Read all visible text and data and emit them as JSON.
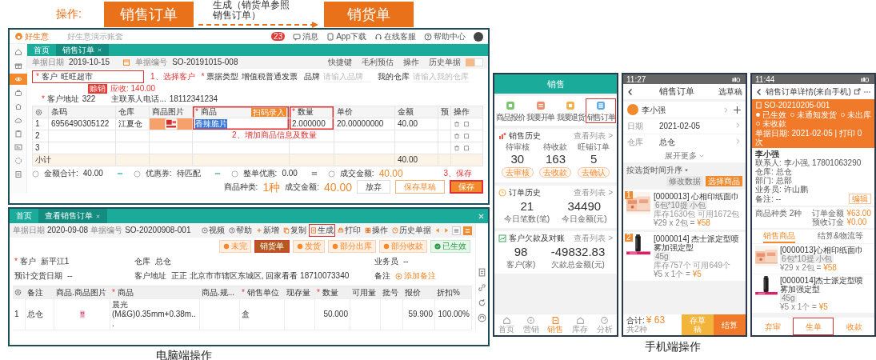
{
  "flow": {
    "label": "操作:",
    "from": "销售订单",
    "via": "生成（销货单参照销售订单）",
    "to": "销货单"
  },
  "pc_edit": {
    "logo": "好生意",
    "account": "好生意演示账套",
    "top_actions": [
      {
        "kind": "message",
        "label": "消息",
        "badge": "23"
      },
      {
        "kind": "app",
        "label": "App下载"
      },
      {
        "kind": "service",
        "label": "在线客服"
      },
      {
        "kind": "help",
        "label": "帮助中心"
      }
    ],
    "sidebar": [
      {
        "kind": "home",
        "selected": false
      },
      {
        "kind": "gift",
        "selected": false
      },
      {
        "kind": "eye",
        "selected": true
      },
      {
        "kind": "bag",
        "selected": false
      },
      {
        "kind": "house",
        "selected": false
      },
      {
        "kind": "cloud",
        "selected": false
      },
      {
        "kind": "clipboard",
        "selected": false
      },
      {
        "kind": "card",
        "selected": false
      },
      {
        "kind": "ring",
        "selected": false
      },
      {
        "kind": "doc",
        "selected": false
      }
    ],
    "tabs": [
      {
        "label": "首页",
        "selected": false,
        "closable": false
      },
      {
        "label": "销售订单",
        "selected": true,
        "closable": true
      }
    ],
    "date_label": "单据日期",
    "date": "2019-10-15",
    "number_label": "单据编号",
    "number": "SO-20191015-008",
    "header_actions": [
      "快捷键",
      "毛利预估",
      "操作",
      "历史单据"
    ],
    "view_toggle": [
      {
        "selected": true
      },
      {
        "selected": false
      }
    ],
    "customer": {
      "mark": "*",
      "label": "客户",
      "value": "旺旺超市",
      "highlighted": true,
      "badge": "赊销",
      "receivable": "应收: 140.00"
    },
    "step1": "1、选择客户",
    "invoice": {
      "mark": "*",
      "label": "票据类型",
      "value": "增值税普通发票"
    },
    "brand": {
      "label": "品牌",
      "placeholder": "请输入品牌"
    },
    "warehouse": {
      "label": "我的仓库",
      "placeholder": "请输入我的仓库"
    },
    "address": {
      "mark": "*",
      "label": "客户地址",
      "value": "322"
    },
    "contact": {
      "label": "主联系人电话...",
      "value": "18112341234"
    },
    "columns": [
      {
        "label": "条码",
        "highlighted": false
      },
      {
        "label": "仓库",
        "highlighted": false
      },
      {
        "label": "商品图片",
        "highlighted": false
      },
      {
        "mark": "*",
        "label": "商品",
        "highlighted": true,
        "badge": "扫码录入"
      },
      {
        "mark": "*",
        "label": "数量",
        "highlighted": true
      },
      {
        "label": "单价",
        "highlighted": false
      },
      {
        "label": "金额",
        "highlighted": false
      },
      {
        "label": "预",
        "highlighted": false
      },
      {
        "label": "操作",
        "highlighted": false
      }
    ],
    "rows": [
      {
        "index": "1",
        "barcode": "6956490305122",
        "warehouse": "江夏仓",
        "has_picture": true,
        "product": "香辣脆片",
        "quantity": "2.000000",
        "price": "20.00000000",
        "amount": "40.00"
      },
      {
        "index": "2",
        "has_picture": false
      },
      {
        "index": "3",
        "has_picture": false
      }
    ],
    "subtotal": {
      "label": "小计",
      "amount": "40.00"
    },
    "step2": "2、增加商品信息及数量",
    "totals": [
      {
        "label": "金额合计:",
        "value": "40.00",
        "kind": "minus"
      },
      {
        "label": "优惠券:",
        "value": "待匹配",
        "kind": "minus"
      },
      {
        "label": "整单优惠:",
        "value": "0.00",
        "kind": "equals"
      },
      {
        "label": "成交金额:",
        "value": "40.00",
        "kind": "result"
      }
    ],
    "step3": "3、保存",
    "footer": {
      "kinds_label": "商品种类:",
      "kinds": "1种",
      "amount_label": "成交金额:",
      "amount": "40.00",
      "buttons": [
        {
          "label": "放弃",
          "kind": "plain",
          "highlighted": false
        },
        {
          "label": "保存草稿",
          "kind": "outline",
          "highlighted": false
        },
        {
          "label": "保存",
          "kind": "primary",
          "highlighted": true
        }
      ]
    }
  },
  "pc_view": {
    "tabs": [
      {
        "label": "首页",
        "selected": false,
        "closable": false
      },
      {
        "label": "查看销售订单",
        "selected": true,
        "closable": true
      }
    ],
    "date_label": "单据日期",
    "date": "2020-09-08",
    "number_label": "单据编号",
    "number": "SO-20200908-001",
    "toolbar": [
      {
        "kind": "video",
        "label": "视频",
        "highlighted": false
      },
      {
        "kind": "help",
        "label": "帮助",
        "highlighted": false
      },
      {
        "kind": "add",
        "label": "新增",
        "highlighted": false
      },
      {
        "kind": "copy",
        "label": "复制",
        "highlighted": false
      },
      {
        "kind": "generate",
        "label": "生成",
        "highlighted": true
      },
      {
        "kind": "print",
        "label": "打印",
        "highlighted": false
      },
      {
        "kind": "ops",
        "label": "操作",
        "highlighted": false
      },
      {
        "kind": "history",
        "label": "历史单据",
        "highlighted": false
      }
    ],
    "menu_item": "销货单",
    "chips": [
      {
        "label": "未完",
        "done": false
      },
      {
        "label": "发货",
        "done": false
      },
      {
        "label": "部分出库",
        "done": false
      },
      {
        "label": "部分收款",
        "done": false
      },
      {
        "label": "已生效",
        "done": true
      }
    ],
    "fields": [
      {
        "mark": "*",
        "label": "客户",
        "value": "新平江1",
        "kind": "text"
      },
      {
        "label": "仓库",
        "value": "总仓",
        "kind": "text"
      },
      {
        "label": "业务员",
        "value": "--",
        "kind": "text"
      },
      {
        "label": "预计交货日期",
        "value": "--",
        "kind": "text"
      },
      {
        "label": "客户地址",
        "value": "正正 北京市市辖区东城区, 回家看看 18710073340",
        "kind": "text"
      },
      {
        "label": "备注",
        "value": "添加备注",
        "kind": "link"
      }
    ],
    "columns": [
      {
        "label": "备注"
      },
      {
        "label": "商品.商品图片"
      },
      {
        "mark": "*",
        "label": "商品"
      },
      {
        "label": "商品.规..."
      },
      {
        "mark": "*",
        "label": "销售单位"
      },
      {
        "label": "现存量"
      },
      {
        "mark": "*",
        "label": "数量"
      },
      {
        "label": "可用量"
      },
      {
        "label": "批号"
      },
      {
        "label": "报价"
      },
      {
        "label": "折扣%"
      }
    ],
    "rows": [
      {
        "index": "1",
        "cells": [
          {
            "kind": "text",
            "text": "总仓"
          },
          {
            "kind": "picture"
          },
          {
            "kind": "text",
            "text": "晨光 (M&G)0.35mm+0.38m..."
          },
          {
            "kind": "empty"
          },
          {
            "kind": "text",
            "text": "盒"
          },
          {
            "kind": "empty"
          },
          {
            "kind": "number",
            "text": "50.000"
          },
          {
            "kind": "empty"
          },
          {
            "kind": "empty"
          },
          {
            "kind": "number",
            "text": "59.900"
          },
          {
            "kind": "number",
            "text": "100.00%"
          }
        ]
      }
    ]
  },
  "pc_caption": "电脑端操作",
  "phone_home": {
    "title": "销售",
    "tiles": [
      {
        "kind": "quote",
        "label": "商品报价",
        "highlighted": false
      },
      {
        "kind": "order",
        "label": "我要开单",
        "highlighted": false
      },
      {
        "kind": "return",
        "label": "我要退货",
        "highlighted": false
      },
      {
        "kind": "list",
        "label": "销售订单",
        "highlighted": true
      }
    ],
    "sections": [
      {
        "kind": "history",
        "title": "销售历史",
        "link": "查看列表 >",
        "stats": [
          {
            "label": "待审核",
            "value": "30",
            "action": "去审核"
          },
          {
            "label": "待收款",
            "value": "163",
            "action": "去收款"
          },
          {
            "label": "旺铺订单",
            "value": "5",
            "action": "去确认"
          }
        ]
      },
      {
        "kind": "orders",
        "title": "订单历史",
        "link": "查看列表 >",
        "stats": [
          {
            "value": "21",
            "label": "今日笔数(笔)"
          },
          {
            "value": "34490",
            "label": "今日金额(元)"
          }
        ]
      },
      {
        "kind": "debt",
        "title": "客户欠款及对账",
        "link": "查看列表 >",
        "stats": [
          {
            "value": "98",
            "label": "客户(家)"
          },
          {
            "value": "-49832.83",
            "label": "欠款总金额(元)"
          }
        ]
      }
    ],
    "nav": [
      {
        "kind": "home",
        "label": "首页",
        "selected": false
      },
      {
        "kind": "market",
        "label": "营销",
        "selected": false
      },
      {
        "kind": "sales",
        "label": "销售",
        "selected": true
      },
      {
        "kind": "stock",
        "label": "库存",
        "selected": false
      },
      {
        "kind": "analysis",
        "label": "分析",
        "selected": false
      }
    ]
  },
  "phone_order": {
    "time": "11:27",
    "title": "销售订单",
    "action": "选草稿",
    "customer": "李小强",
    "rows": [
      {
        "label": "日期",
        "value": "2021-02-05"
      },
      {
        "label": "仓库",
        "value": "总仓"
      }
    ],
    "more": "展开更多",
    "sort": "按选货时间升序",
    "buttons": [
      {
        "label": "修改数据",
        "kind": "secondary"
      },
      {
        "label": "选择商品",
        "kind": "primary"
      }
    ],
    "items": [
      {
        "no": "1",
        "name": "[0000013] 心相印纸面巾",
        "spec": "6包*10提 小包",
        "stock": "库存1630包 可用1672包",
        "price": "¥29 x 2包 =",
        "subtotal": "¥58"
      },
      {
        "no": "2",
        "name": "[0000014] 杰士派定型喷雾加强定型",
        "spec": "45g",
        "stock": "库存757个 可用649个",
        "price": "¥5 x 1个 =",
        "subtotal": "¥5"
      }
    ],
    "total_label": "合计:",
    "total": "¥ 63",
    "count": "共2种",
    "footer_buttons": [
      {
        "label": "存草稿",
        "kind": "draft"
      },
      {
        "label": "结算",
        "kind": "primary"
      }
    ]
  },
  "phone_detail": {
    "time": "11:44",
    "title": "销售订单详情(来自手机)",
    "number": "SO-20210205-001",
    "statuses": [
      {
        "label": "已生效",
        "done": true
      },
      {
        "label": "未通知发货",
        "done": false
      },
      {
        "label": "未出库",
        "done": false
      },
      {
        "label": "未收款",
        "done": false
      }
    ],
    "date_line": "单据日期: 2021-02-05 | 打印 0 次",
    "customer": "李小强",
    "info": [
      "联系人: 李小强, 17801063290",
      "仓库: 总仓",
      "部门: 总部",
      "业务员: 许山鹏",
      "备注: --"
    ],
    "edit": "编辑",
    "kinds": "商品种类  2种",
    "amounts": [
      {
        "label": "订单金额",
        "value": "¥63.00"
      },
      {
        "label": "预收订金",
        "value": "¥0.00"
      }
    ],
    "tabs": [
      {
        "label": "销售商品",
        "selected": true
      },
      {
        "label": "结算&物流等",
        "selected": false
      }
    ],
    "items": [
      {
        "name": "[0000013]心相印纸面巾",
        "spec": "6包*10提 小包",
        "price": "¥29 x 2包 =",
        "subtotal": "¥58"
      },
      {
        "name": "[0000014]杰士派定型喷雾加强定型",
        "spec": "45g",
        "price": "¥5 x 1个 =",
        "subtotal": "¥5"
      }
    ],
    "actions": [
      {
        "label": "弃审",
        "highlighted": false
      },
      {
        "label": "生单",
        "highlighted": true
      },
      {
        "label": "收款",
        "highlighted": false
      }
    ]
  },
  "phone_caption": "手机端操作"
}
